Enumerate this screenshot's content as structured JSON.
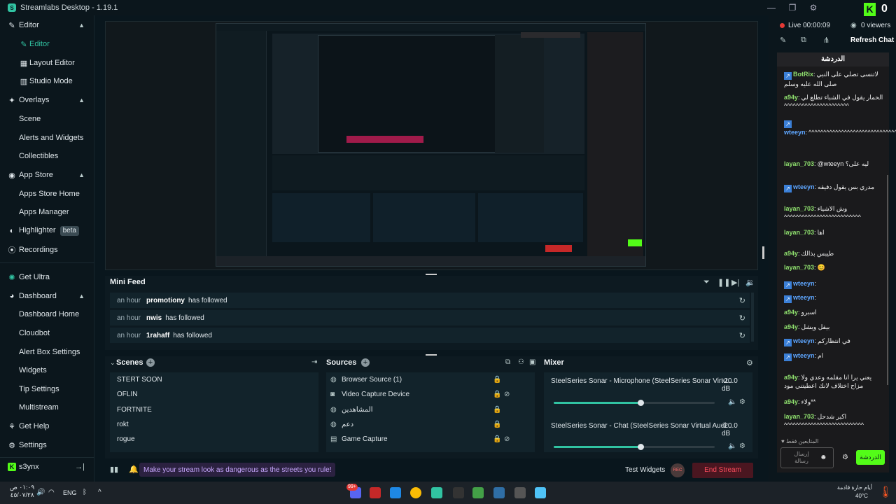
{
  "window": {
    "title": "Streamlabs Desktop - 1.19.1"
  },
  "sidebar": {
    "items": [
      {
        "label": "Editor",
        "icon": "brush-icon"
      },
      {
        "label": "Editor",
        "icon": "brush-icon"
      },
      {
        "label": "Layout Editor",
        "icon": "layout-icon"
      },
      {
        "label": "Studio Mode",
        "icon": "studio-icon"
      },
      {
        "label": "Overlays",
        "icon": "overlays-icon"
      },
      {
        "label": "Scene"
      },
      {
        "label": "Alerts and Widgets"
      },
      {
        "label": "Collectibles"
      },
      {
        "label": "App Store",
        "icon": "store-icon"
      },
      {
        "label": "Apps Store Home"
      },
      {
        "label": "Apps Manager"
      },
      {
        "label": "Highlighter",
        "badge": "beta",
        "icon": "highlighter-icon"
      },
      {
        "label": "Recordings",
        "icon": "record-icon"
      },
      {
        "label": "Get Ultra",
        "icon": "ultra-icon"
      },
      {
        "label": "Dashboard",
        "icon": "dashboard-icon"
      },
      {
        "label": "Dashboard Home"
      },
      {
        "label": "Cloudbot"
      },
      {
        "label": "Alert Box Settings"
      },
      {
        "label": "Widgets"
      },
      {
        "label": "Tip Settings"
      },
      {
        "label": "Multistream"
      },
      {
        "label": "Get Help",
        "icon": "help-icon"
      },
      {
        "label": "Settings",
        "icon": "gear-icon"
      },
      {
        "label": "s3ynx",
        "icon": "kick-icon"
      }
    ]
  },
  "mini_feed": {
    "title": "Mini Feed",
    "rows": [
      {
        "time": "an hour",
        "name": "promotiony",
        "action": "has followed"
      },
      {
        "time": "an hour",
        "name": "nwis",
        "action": "has followed"
      },
      {
        "time": "an hour",
        "name": "1rahaff",
        "action": "has followed"
      }
    ]
  },
  "scenes": {
    "title": "Scenes",
    "items": [
      "STERT SOON",
      "OFLIN",
      "FORTNITE",
      "rokt",
      "rogue"
    ]
  },
  "sources": {
    "title": "Sources",
    "items": [
      {
        "label": "Browser Source (1)",
        "icon": "globe-icon"
      },
      {
        "label": "Video Capture Device",
        "icon": "camera-icon"
      },
      {
        "label": "المشاهدين",
        "icon": "globe-icon"
      },
      {
        "label": "دعم",
        "icon": "globe-icon"
      },
      {
        "label": "Game Capture",
        "icon": "gamepad-icon"
      }
    ]
  },
  "mixer": {
    "title": "Mixer",
    "items": [
      {
        "label": "SteelSeries Sonar - Microphone (SteelSeries Sonar Virtu...",
        "db": "-20.0 dB",
        "level": 0.54
      },
      {
        "label": "SteelSeries Sonar - Chat (SteelSeries Sonar Virtual Audi...",
        "db": "-20.0 dB",
        "level": 0.54
      }
    ]
  },
  "bottom": {
    "banner": "Make your stream look as dangerous as the streets you rule!",
    "test_widgets": "Test Widgets",
    "rec": "REC",
    "end_stream": "End Stream"
  },
  "chat": {
    "live": "Live 00:00:09",
    "viewers": "0 viewers",
    "refresh": "Refresh Chat",
    "viewer_count": "0",
    "header": "الدردشة",
    "messages": [
      {
        "user": "BotRix",
        "text": "لاتنسى تصلي على النبي صلى الله عليه وسلم",
        "color": "green",
        "bolt": true
      },
      {
        "user": "a94y",
        "text": "الحمار يقول في الشباء تطلع لي ^^^^^^^^^^^^^^^^^^^^^^",
        "color": "green",
        "bolt": false
      },
      {
        "user": "wteeyn",
        "text": "^^^^^^^^^^^^^^^^^^^^^^^^^^^^^^^^^^^^^^^^^^^^^^^^^^^^^^^^^^^^^^^^^^^^^^^",
        "color": "blue",
        "bolt": true
      },
      {
        "user": "layan_703",
        "text": "@wteeyn ليه على؟",
        "color": "green",
        "bolt": false
      },
      {
        "user": "wteeyn",
        "text": "مدري بس يقول دفيقه",
        "color": "blue",
        "bolt": true
      },
      {
        "user": "layan_703",
        "text": "وش الاشياء ^^^^^^^^^^^^^^^^^^^^^^^^^^",
        "color": "green",
        "bolt": false
      },
      {
        "user": "layan_703",
        "text": "اها",
        "color": "green",
        "bolt": false
      },
      {
        "user": "a94y",
        "text": "طيبس بذالك",
        "color": "green",
        "bolt": false
      },
      {
        "user": "layan_703",
        "text": "😊",
        "color": "green",
        "bolt": false
      },
      {
        "user": "wteeyn",
        "text": "",
        "color": "blue",
        "bolt": true
      },
      {
        "user": "wteeyn",
        "text": "",
        "color": "blue",
        "bolt": true
      },
      {
        "user": "a94y",
        "text": "اسبرو",
        "color": "green",
        "bolt": false
      },
      {
        "user": "a94y",
        "text": "بيفل ويشل",
        "color": "green",
        "bolt": false
      },
      {
        "user": "wteeyn",
        "text": "في انتظاركم",
        "color": "blue",
        "bolt": true
      },
      {
        "user": "wteeyn",
        "text": "ام",
        "color": "blue",
        "bolt": true
      },
      {
        "user": "a94y",
        "text": "يعني يرا انا مقلمه وعدي ولا مزاح اختلاف لانك اعطيتني مود",
        "color": "green",
        "bolt": false
      },
      {
        "user": "a94y",
        "text": "ولاء**",
        "color": "green",
        "bolt": false
      },
      {
        "user": "layan_703",
        "text": "اكبر شدحل ^^^^^^^^^^^^^^^^^^^^^^^^^^^",
        "color": "green",
        "bolt": false
      }
    ],
    "footer_label": "المتابعين فقط",
    "input_placeholder": "إرسال رسالة",
    "send": "الدردشة"
  },
  "taskbar": {
    "date": "٤٥/٠٧/٢٨",
    "time": "٠١:٠٩ ص",
    "lang": "ENG",
    "weather_label": "أيام حارة قادمة",
    "weather_temp": "40°C",
    "notif": "99+"
  }
}
